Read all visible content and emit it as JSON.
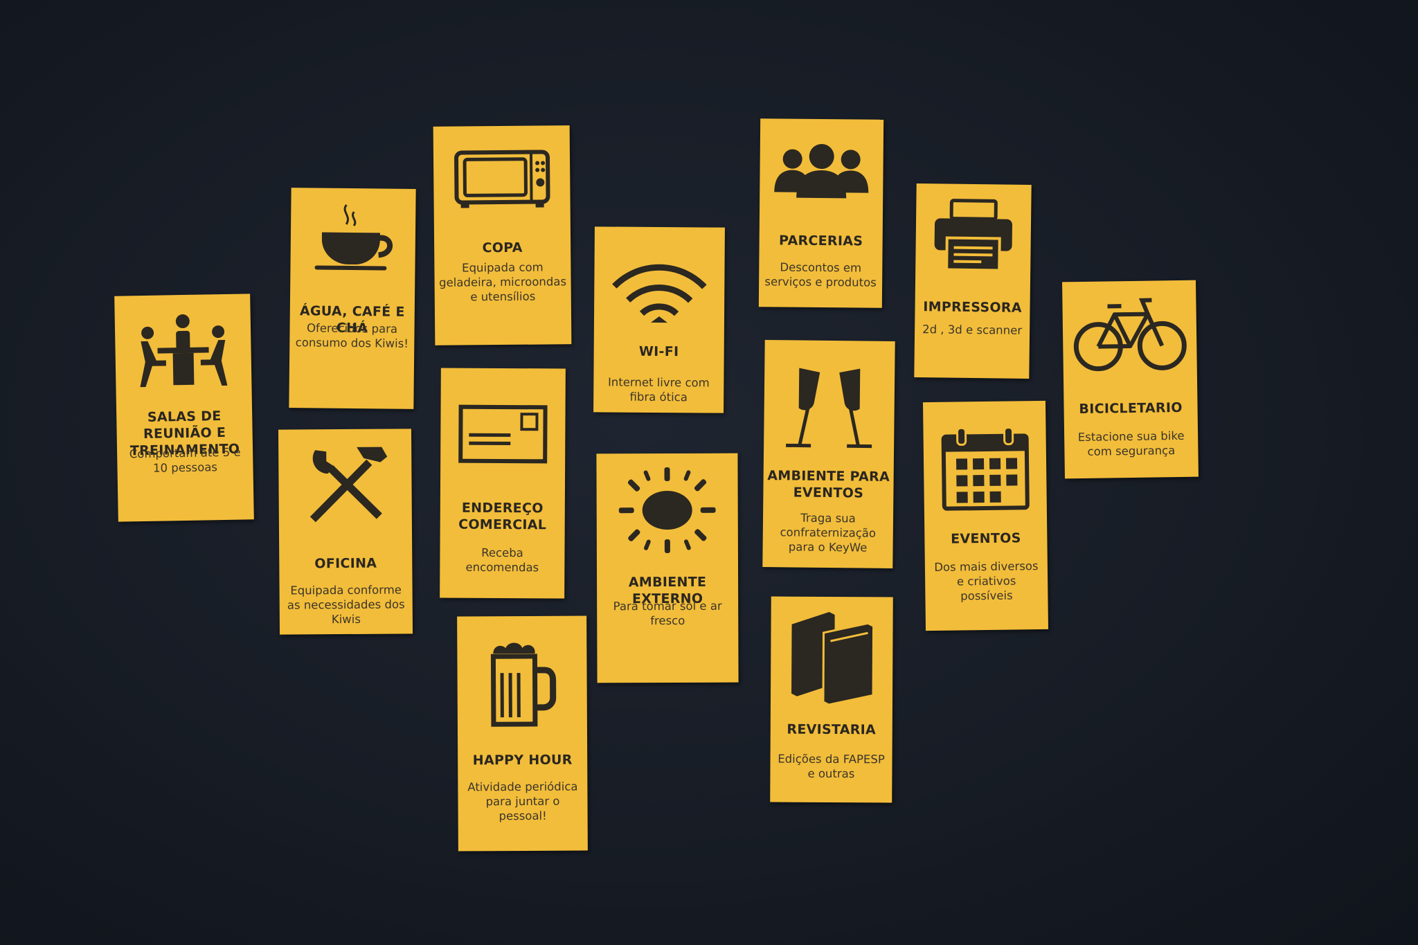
{
  "cards": [
    {
      "id": "salas",
      "title": "SALAS DE REUNIÃO E TREINAMENTO",
      "desc": "Comportam até 5 e 10 pessoas",
      "icon": "meeting-icon"
    },
    {
      "id": "agua",
      "title": "ÁGUA, CAFÉ E CHÁ",
      "desc": "Oferecidos para consumo dos Kiwis!",
      "icon": "coffee-cup-icon"
    },
    {
      "id": "copa",
      "title": "COPA",
      "desc": "Equipada com geladeira, microondas e utensílios",
      "icon": "microwave-icon"
    },
    {
      "id": "wifi",
      "title": "WI-FI",
      "desc": "Internet livre com fibra ótica",
      "icon": "wifi-icon"
    },
    {
      "id": "parcerias",
      "title": "PARCERIAS",
      "desc": "Descontos em serviços e produtos",
      "icon": "people-icon"
    },
    {
      "id": "impressora",
      "title": "IMPRESSORA",
      "desc": "2d , 3d e scanner",
      "icon": "printer-icon"
    },
    {
      "id": "bicicletario",
      "title": "BICICLETARIO",
      "desc": "Estacione sua bike com segurança",
      "icon": "bicycle-icon"
    },
    {
      "id": "oficina",
      "title": "OFICINA",
      "desc": "Equipada conforme as necessidades dos Kiwis",
      "icon": "tools-icon"
    },
    {
      "id": "endereco",
      "title": "ENDEREÇO COMERCIAL",
      "desc": "Receba  encomendas",
      "icon": "envelope-icon"
    },
    {
      "id": "externo",
      "title": "AMBIENTE EXTERNO",
      "desc": "Para tomar sol e ar fresco",
      "icon": "sun-icon"
    },
    {
      "id": "eventos_amb",
      "title": "AMBIENTE PARA EVENTOS",
      "desc": "Traga sua confraternização para o KeyWe",
      "icon": "champagne-icon"
    },
    {
      "id": "eventos",
      "title": "EVENTOS",
      "desc": "Dos mais diversos e criativos possíveis",
      "icon": "calendar-icon"
    },
    {
      "id": "happy",
      "title": "HAPPY HOUR",
      "desc": "Atividade periódica para juntar o pessoal!",
      "icon": "beer-mug-icon"
    },
    {
      "id": "revistaria",
      "title": "REVISTARIA",
      "desc": "Edições da FAPESP e outras",
      "icon": "books-icon"
    }
  ]
}
